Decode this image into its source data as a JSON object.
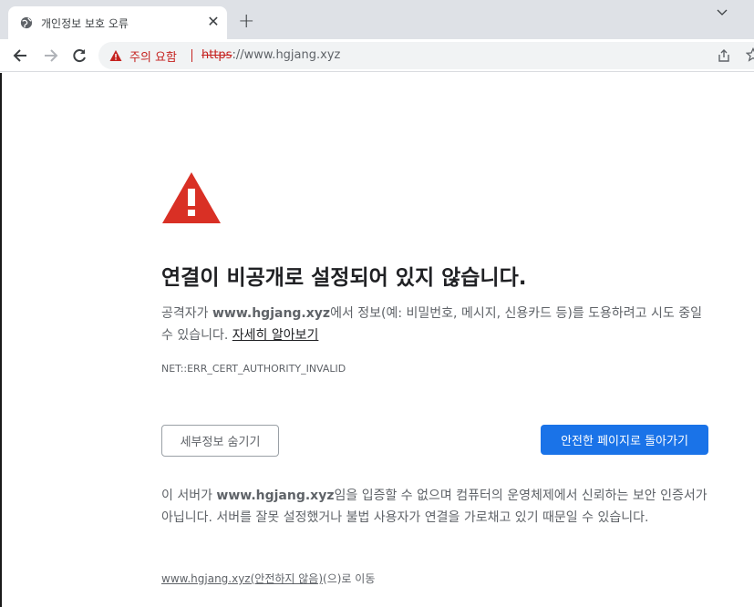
{
  "tab": {
    "title": "개인정보 보호 오류",
    "close_glyph": "✕",
    "favicon": "globe-icon",
    "new_tab_glyph": "+"
  },
  "toolbar": {
    "security_chip": "주의 요함",
    "url_scheme": "https",
    "url_rest": "://www.hgjang.xyz",
    "icons": [
      "back-arrow-icon",
      "forward-arrow-icon",
      "reload-icon",
      "warning-icon",
      "share-icon",
      "star-icon"
    ]
  },
  "page": {
    "heading": "연결이 비공개로 설정되어 있지 않습니다.",
    "desc_prefix": "공격자가 ",
    "desc_domain": "www.hgjang.xyz",
    "desc_suffix": "에서 정보(예: 비밀번호, 메시지, 신용카드 등)를 도용하려고 시도 중일 수 있습니다. ",
    "learn_more": "자세히 알아보기",
    "error_code": "NET::ERR_CERT_AUTHORITY_INVALID",
    "details_button": "세부정보 숨기기",
    "back_button": "안전한 페이지로 돌아가기",
    "details_prefix": "이 서버가 ",
    "details_domain": "www.hgjang.xyz",
    "details_suffix": "임을 입증할 수 없으며 컴퓨터의 운영체제에서 신뢰하는 보안 인증서가 아닙니다. 서버를 잘못 설정했거나 불법 사용자가 연결을 가로채고 있기 때문일 수 있습니다.",
    "proceed_link": "www.hgjang.xyz(안전하지 않음)",
    "proceed_suffix": "(으)로 이동"
  },
  "colors": {
    "warning_red": "#d93025",
    "primary_blue": "#1a73e8",
    "tabstrip_bg": "#dee1e6"
  }
}
